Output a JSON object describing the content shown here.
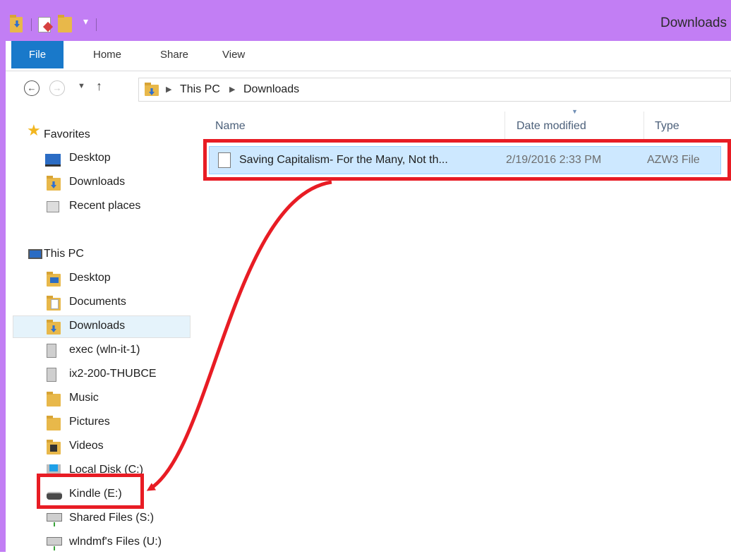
{
  "window": {
    "title": "Downloads"
  },
  "ribbon": {
    "tabs": [
      "File",
      "Home",
      "Share",
      "View"
    ]
  },
  "address": {
    "crumbs": [
      "This PC",
      "Downloads"
    ]
  },
  "nav": {
    "favorites": {
      "label": "Favorites",
      "items": [
        "Desktop",
        "Downloads",
        "Recent places"
      ]
    },
    "this_pc": {
      "label": "This PC",
      "items": [
        "Desktop",
        "Documents",
        "Downloads",
        "exec (wln-it-1)",
        "ix2-200-THUBCE",
        "Music",
        "Pictures",
        "Videos",
        "Local Disk (C:)",
        "Kindle (E:)",
        "Shared Files (S:)",
        "wlndmf's Files (U:)"
      ],
      "selected": "Downloads"
    }
  },
  "content": {
    "columns": [
      "Name",
      "Date modified",
      "Type"
    ],
    "files": [
      {
        "name": "Saving Capitalism- For the Many, Not th...",
        "date": "2/19/2016 2:33 PM",
        "type": "AZW3 File"
      }
    ]
  },
  "colors": {
    "title_bar": "#c27ef4",
    "file_tab": "#1979ca",
    "selection": "#cde8ff",
    "annotation": "#e81c24"
  }
}
